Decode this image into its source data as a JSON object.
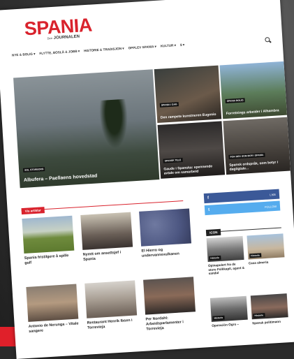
{
  "site": {
    "logo_text": "SPANIA",
    "logo_sub_prefix": "Den",
    "logo_sub": "JOURNALEN"
  },
  "nav": {
    "items": [
      "NYE & BOLIG ▾",
      "FLYTTE, BOSLÅ & JOBB ▾",
      "HISTORIE & TRADISJON ▾",
      "OPPLEV SPANIA ▾",
      "KULTUR ▾",
      "$ ▾"
    ]
  },
  "hero": {
    "main": {
      "category": "SOL STORBORG",
      "title": "Albufera – Paellaens hovedstad"
    },
    "tiles": [
      {
        "category": "SPANIA I DAG",
        "title": "Den rampete kunstneren Eugenio"
      },
      {
        "category": "SPANIA BOLIG",
        "title": "Forretnings arbeider i Alhambra"
      },
      {
        "category": "SPANSK TELE",
        "title": "Gaude i Spanska: spennende avtale om samarbeid"
      },
      {
        "category": "FOR DEG SOM BOR I SPANIA",
        "title": "Spansk ordspråk, som betyr i dagligtale..."
      }
    ]
  },
  "section": {
    "label": "Vis artiklar"
  },
  "articles": [
    {
      "title": "Spania fristilgere å spille golf"
    },
    {
      "title": "Nymtt om ansettsjef i Spania"
    },
    {
      "title": "El Hierro og undervannsvulkanen"
    },
    {
      "title": "Antonio de Nerunga – Vitale sangere"
    },
    {
      "title": "Restaurant Henrik Ibsen i Torrevieja"
    },
    {
      "title": "Per Nordahl: Arbeidsparlamenter i Torrevieja"
    }
  ],
  "sidebar": {
    "facebook": {
      "icon": "f",
      "count": "LIKE"
    },
    "twitter": {
      "icon": "t",
      "count": "FOLLOW"
    },
    "label": "ICON",
    "items": [
      {
        "category": "Historie",
        "title": "Opinapulert fra de store Folkkapil, agent & sandal"
      },
      {
        "category": "Historie",
        "title": "Casa almeria"
      },
      {
        "category": "Historie",
        "title": "Operación Ogro –"
      },
      {
        "category": "Historie",
        "title": "Spansk politimann"
      }
    ]
  },
  "colors": {
    "brand": "#d9232d",
    "facebook": "#3b5998",
    "twitter": "#55acee"
  }
}
